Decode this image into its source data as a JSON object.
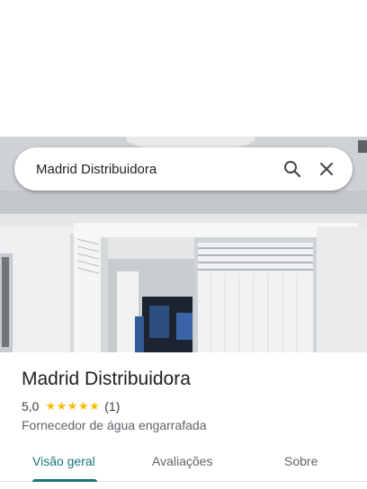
{
  "search": {
    "value": "Madrid Distribuidora"
  },
  "icons": {
    "search": "search-icon",
    "close": "close-icon",
    "star": "star-icon"
  },
  "place": {
    "name": "Madrid Distribuidora",
    "rating": "5,0",
    "stars": "★★★★★",
    "rating_value": 5,
    "review_count": "(1)",
    "category": "Fornecedor de água engarrafada"
  },
  "tabs": [
    {
      "label": "Visão geral",
      "active": true
    },
    {
      "label": "Avaliações",
      "active": false
    },
    {
      "label": "Sobre",
      "active": false
    }
  ],
  "colors": {
    "accent": "#1a7373",
    "star": "#fbbc04",
    "text": "#202124",
    "muted": "#5f6368"
  }
}
